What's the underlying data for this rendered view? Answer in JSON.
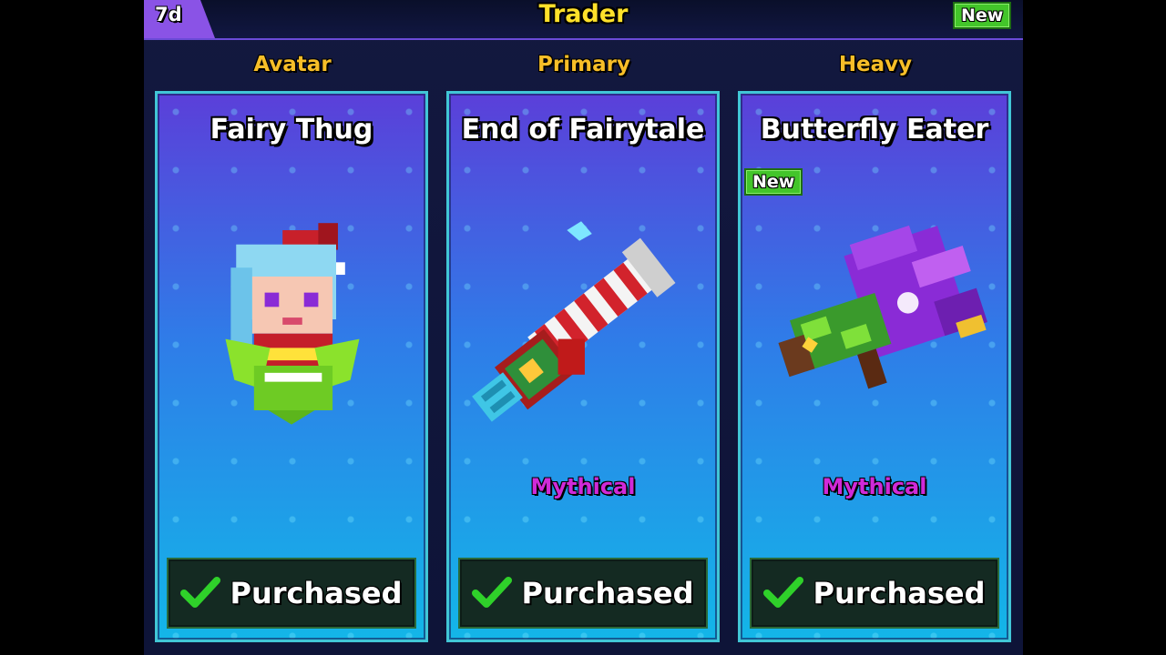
{
  "header": {
    "timer": "7d",
    "title": "Trader",
    "new_badge": "New"
  },
  "columns": [
    {
      "category": "Avatar",
      "item_name": "Fairy Thug",
      "rarity": "",
      "status": "Purchased"
    },
    {
      "category": "Primary",
      "item_name": "End of Fairytale",
      "rarity": "Mythical",
      "status": "Purchased"
    },
    {
      "category": "Heavy",
      "item_name": "Butterfly Eater",
      "new_badge": "New",
      "rarity": "Mythical",
      "status": "Purchased"
    }
  ],
  "colors": {
    "title": "#ffe12a",
    "category": "#f7be28",
    "rarity_mythical": "#d02ad8",
    "new_badge": "#43c52a",
    "check": "#2fd12a"
  },
  "icons": [
    "check-icon",
    "avatar-art",
    "candy-cane-gun-icon",
    "butterfly-eater-gun-icon"
  ]
}
